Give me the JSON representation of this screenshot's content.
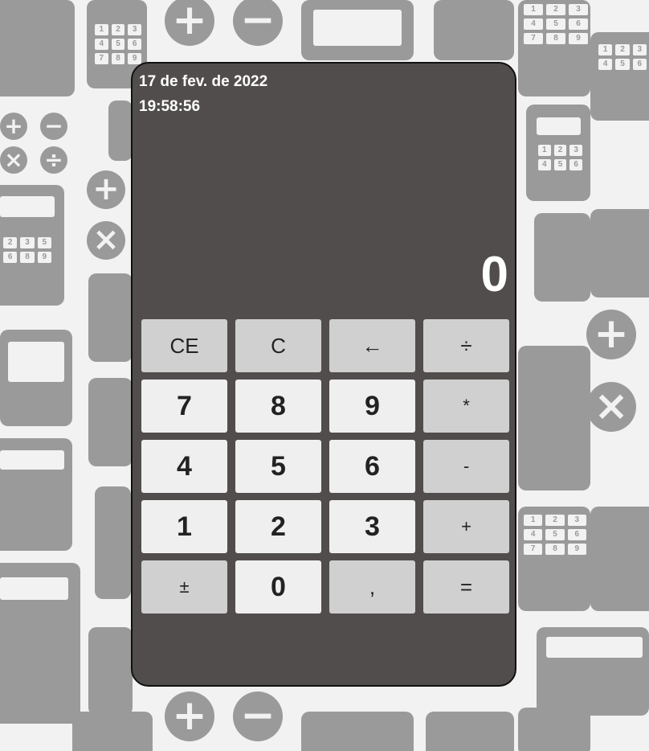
{
  "calculator": {
    "date": "17 de fev. de 2022",
    "time": "19:58:56",
    "display": "0",
    "keys": {
      "ce": "CE",
      "c": "C",
      "backspace": "←",
      "divide": "÷",
      "seven": "7",
      "eight": "8",
      "nine": "9",
      "multiply": "*",
      "four": "4",
      "five": "5",
      "six": "6",
      "minus": "-",
      "one": "1",
      "two": "2",
      "three": "3",
      "plus": "+",
      "sign": "±",
      "zero": "0",
      "comma": ",",
      "equals": "="
    }
  },
  "background": {
    "glyphs": {
      "plus": "+",
      "minus": "−",
      "times": "×",
      "divide": "÷"
    },
    "key_digits": [
      "1",
      "2",
      "3",
      "4",
      "5",
      "6",
      "7",
      "8",
      "9"
    ]
  },
  "colors": {
    "calculator_body": "#514d4c",
    "number_key": "#efefef",
    "function_key": "#d0d0d0",
    "background_pattern": "#9a9a9a"
  }
}
